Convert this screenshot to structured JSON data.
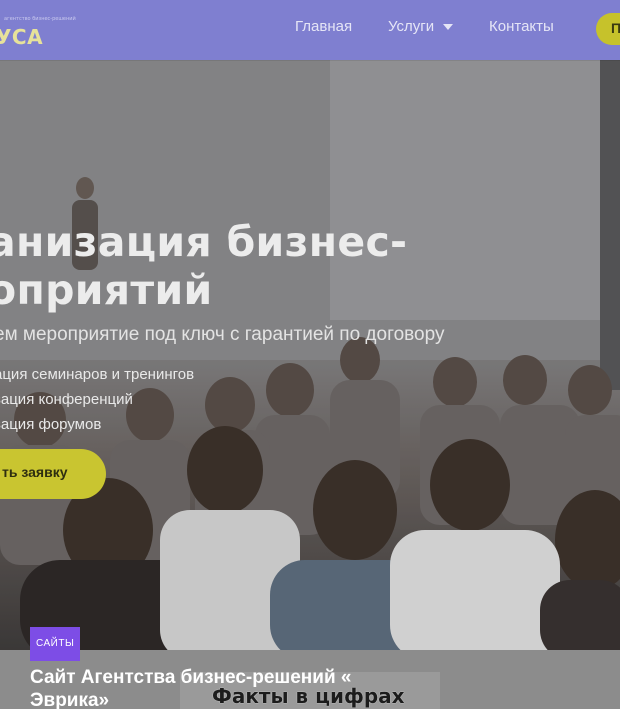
{
  "header": {
    "logo_tagline": "агентство бизнес-решений",
    "logo_text": "УСА",
    "nav": {
      "home": "Главная",
      "services": "Услуги",
      "contacts": "Контакты"
    },
    "cta_label": "П"
  },
  "hero": {
    "title_line1": "анизация бизнес-",
    "title_line2": "оприятий",
    "subtitle": "ем мероприятие под ключ с гарантией по договору",
    "list": [
      "ация семинаров и тренингов",
      "зация конференций",
      "зация форумов"
    ],
    "button_label": "ть заявку"
  },
  "card": {
    "tag": "САЙТЫ",
    "title": "Сайт Агентства бизнес-решений « Эврика»",
    "facts_heading": "Факты в цифрах"
  },
  "colors": {
    "header_bg": "#7f7fd0",
    "accent_yellow": "#c9c530",
    "tag_purple": "#7d4de6"
  },
  "icons": {
    "services_dropdown": "chevron-down-icon"
  }
}
